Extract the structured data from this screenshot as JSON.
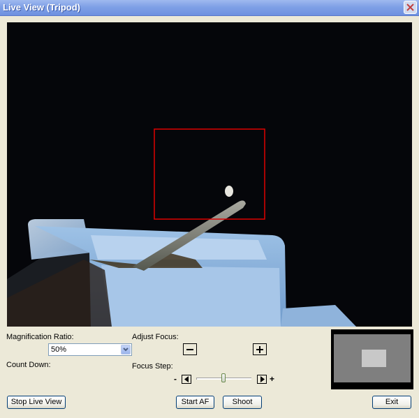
{
  "window": {
    "title": "Live View (Tripod)"
  },
  "controls": {
    "magnification_label": "Magnification Ratio:",
    "magnification_value": "50%",
    "countdown_label": "Count Down:",
    "adjust_focus_label": "Adjust Focus:",
    "focus_step_label": "Focus Step:",
    "step_minus": "-",
    "step_plus": "+",
    "focus_step_slider_fraction": 0.49
  },
  "buttons": {
    "stop_live_view": "Stop Live View",
    "start_af": "Start AF",
    "shoot": "Shoot",
    "exit": "Exit"
  },
  "icons": {
    "close": "close-icon",
    "focus_minus": "minus-icon",
    "focus_plus": "plus-icon",
    "step_left": "triangle-left-icon",
    "step_right": "triangle-right-icon",
    "dropdown": "chevron-down-icon"
  },
  "colors": {
    "titlebar": "#7fa0e6",
    "focus_frame": "#e00000",
    "window_bg": "#ece9d8"
  }
}
